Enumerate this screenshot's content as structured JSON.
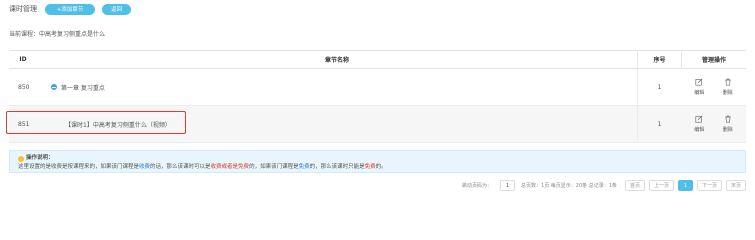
{
  "topbar": {
    "title": "课时管理",
    "add_label": "+添加章节",
    "back_label": "返回"
  },
  "course": {
    "text": "当前课程：中高考复习侧重点是什么"
  },
  "table": {
    "headers": {
      "id": "ID",
      "name": "章节名称",
      "no": "序号",
      "op": "管理操作"
    },
    "rows": [
      {
        "id": "850",
        "name": "第一章 复习重点",
        "no": "1",
        "edit": "编辑",
        "delete": "删除"
      },
      {
        "id": "851",
        "name": "【课时1】中高考复习侧重什么（视频）",
        "no": "1",
        "edit": "编辑",
        "delete": "删除"
      }
    ]
  },
  "note": {
    "title": "操作说明：",
    "p1": "这里设置的是收费是按课程来的，如果该门课程是",
    "w1": "收费",
    "p2": "的话，那么该课时可以是",
    "w2": "收费或者是免费",
    "p3": "的，如果该门课程是",
    "w3": "免费",
    "p4": "的，那么该课时只能是",
    "w4": "免费",
    "p5": "的。"
  },
  "pager": {
    "goto_label": "跳动页码为：",
    "goto_value": "1",
    "summary": "总页数：1页 每页显示：20条 总记录：1条",
    "first": "首页",
    "prev": "上一页",
    "current": "1",
    "next": "下一页",
    "last": "末页"
  },
  "colors": {
    "accent": "#4fbfe6",
    "highlight_border": "#e23a2e",
    "note_bg": "#e9f5fc"
  }
}
